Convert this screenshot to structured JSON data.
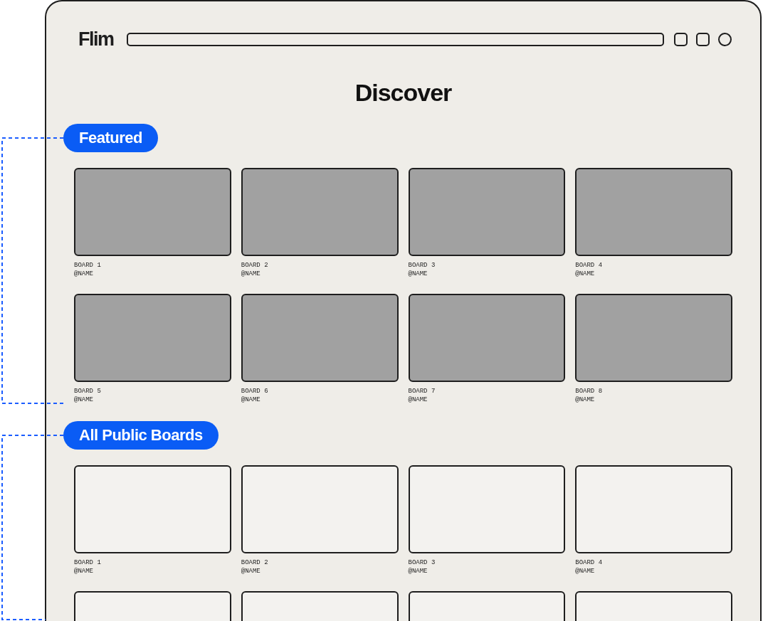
{
  "app": {
    "logo": "Flim"
  },
  "page": {
    "title": "Discover"
  },
  "sections": [
    {
      "title": "Featured",
      "boards": [
        {
          "kind": "filled",
          "title": "BOARD 1",
          "owner": "@NAME"
        },
        {
          "kind": "filled",
          "title": "BOARD 2",
          "owner": "@NAME"
        },
        {
          "kind": "filled",
          "title": "BOARD 3",
          "owner": "@NAME"
        },
        {
          "kind": "filled",
          "title": "BOARD 4",
          "owner": "@NAME"
        },
        {
          "kind": "filled",
          "title": "BOARD 5",
          "owner": "@NAME"
        },
        {
          "kind": "filled",
          "title": "BOARD 6",
          "owner": "@NAME"
        },
        {
          "kind": "filled",
          "title": "BOARD 7",
          "owner": "@NAME"
        },
        {
          "kind": "filled",
          "title": "BOARD 8",
          "owner": "@NAME"
        }
      ]
    },
    {
      "title": "All Public Boards",
      "boards": [
        {
          "kind": "empty",
          "title": "BOARD 1",
          "owner": "@NAME"
        },
        {
          "kind": "empty",
          "title": "BOARD 2",
          "owner": "@NAME"
        },
        {
          "kind": "empty",
          "title": "BOARD 3",
          "owner": "@NAME"
        },
        {
          "kind": "empty",
          "title": "BOARD 4",
          "owner": "@NAME"
        },
        {
          "kind": "empty"
        },
        {
          "kind": "empty"
        },
        {
          "kind": "empty"
        },
        {
          "kind": "empty"
        }
      ]
    }
  ]
}
